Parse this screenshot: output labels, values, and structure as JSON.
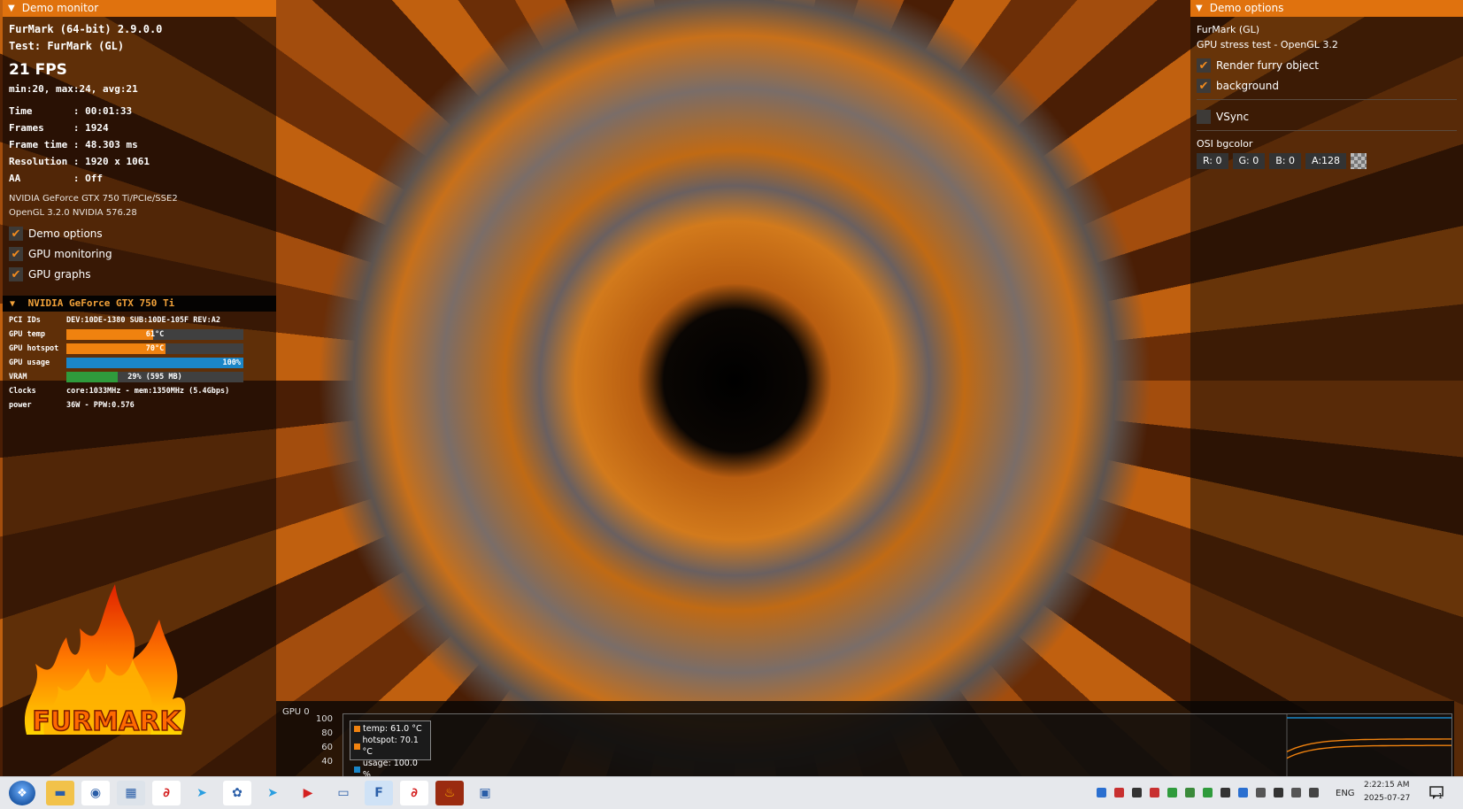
{
  "demo_monitor": {
    "header": "Demo monitor",
    "app_line": "FurMark (64-bit) 2.9.0.0",
    "test_line": "Test: FurMark (GL)",
    "fps": "21 FPS",
    "minmax": "min:20, max:24, avg:21",
    "stats": [
      "Time       : 00:01:33",
      "Frames     : 1924",
      "Frame time : 48.303 ms",
      "Resolution : 1920 x 1061",
      "AA         : Off"
    ],
    "gpu_info": [
      "NVIDIA GeForce GTX 750 Ti/PCIe/SSE2",
      "OpenGL 3.2.0 NVIDIA 576.28"
    ],
    "checkboxes": [
      {
        "label": "Demo options",
        "checked": true
      },
      {
        "label": "GPU monitoring",
        "checked": true
      },
      {
        "label": "GPU graphs",
        "checked": true
      }
    ]
  },
  "gpu_section": {
    "header": "NVIDIA GeForce GTX 750 Ti",
    "pci_label": "PCI IDs",
    "pci_value": "DEV:10DE-1380 SUB:10DE-105F REV:A2",
    "bars": [
      {
        "label": "GPU temp",
        "text": "61°C",
        "fraction": 0.49,
        "color": "#f0820f"
      },
      {
        "label": "GPU hotspot",
        "text": "70°C",
        "fraction": 0.56,
        "color": "#f0820f"
      },
      {
        "label": "GPU usage",
        "text": "100%",
        "fraction": 1.0,
        "color": "#1a86c8"
      },
      {
        "label": "VRAM",
        "text": "29% (595 MB)",
        "fraction": 0.29,
        "color": "#2f9b3c"
      }
    ],
    "clocks_label": "Clocks",
    "clocks_value": "core:1033MHz - mem:1350MHz (5.4Gbps)",
    "power_label": "power",
    "power_value": "36W - PPW:0.576"
  },
  "logo_text": "FURMARK",
  "demo_options": {
    "header": "Demo options",
    "title": "FurMark (GL)",
    "subtitle": "GPU stress test - OpenGL 3.2",
    "checkboxes": [
      {
        "label": "Render furry object",
        "checked": true
      },
      {
        "label": "background",
        "checked": true
      }
    ],
    "vsync": {
      "label": "VSync",
      "checked": false
    },
    "osi_label": "OSI bgcolor",
    "colors": [
      "R: 0",
      "G: 0",
      "B: 0",
      "A:128"
    ]
  },
  "graph": {
    "title": "GPU 0",
    "yticks": [
      "100",
      "80",
      "60",
      "40"
    ],
    "legend": [
      {
        "label": "temp: 61.0 °C",
        "color": "#f0820f"
      },
      {
        "label": "hotspot: 70.1 °C",
        "color": "#f0820f"
      },
      {
        "label": "usage: 100.0 %",
        "color": "#1a86c8"
      }
    ],
    "series": [
      {
        "name": "usage",
        "last_value": 100.0,
        "color": "#1a86c8"
      },
      {
        "name": "hotspot",
        "last_value": 70.1,
        "color": "#f0820f"
      },
      {
        "name": "temp",
        "last_value": 61.0,
        "color": "#f0820f"
      }
    ]
  },
  "taskbar": {
    "apps": [
      {
        "name": "file-explorer-icon",
        "color": "#f2c24a",
        "glyph": "▬"
      },
      {
        "name": "chrome-icon",
        "color": "#ffffff",
        "glyph": "◉"
      },
      {
        "name": "calculator-icon",
        "color": "#dde3ea",
        "glyph": "▦"
      },
      {
        "name": "app-red-icon",
        "color": "#ffffff",
        "glyph": "∂"
      },
      {
        "name": "telegram-icon",
        "color": "#e6e8ec",
        "glyph": "➤"
      },
      {
        "name": "photos-icon",
        "color": "#ffffff",
        "glyph": "✿"
      },
      {
        "name": "telegram-icon-2",
        "color": "#e6e8ec",
        "glyph": "➤"
      },
      {
        "name": "youtube-icon",
        "color": "#e6e8ec",
        "glyph": "▶"
      },
      {
        "name": "notepad-icon",
        "color": "#e6e8ec",
        "glyph": "▭"
      },
      {
        "name": "furmark-app-icon",
        "color": "#cfe2f6",
        "glyph": "F"
      },
      {
        "name": "app-red-icon-2",
        "color": "#ffffff",
        "glyph": "∂"
      },
      {
        "name": "furmark-flame-icon",
        "color": "#9a2b10",
        "glyph": "♨"
      },
      {
        "name": "window-icon",
        "color": "#e6e8ec",
        "glyph": "▣"
      }
    ],
    "lang": "ENG",
    "time": "2:22:15 AM",
    "date": "2025-07-27",
    "notification_count": "1"
  }
}
